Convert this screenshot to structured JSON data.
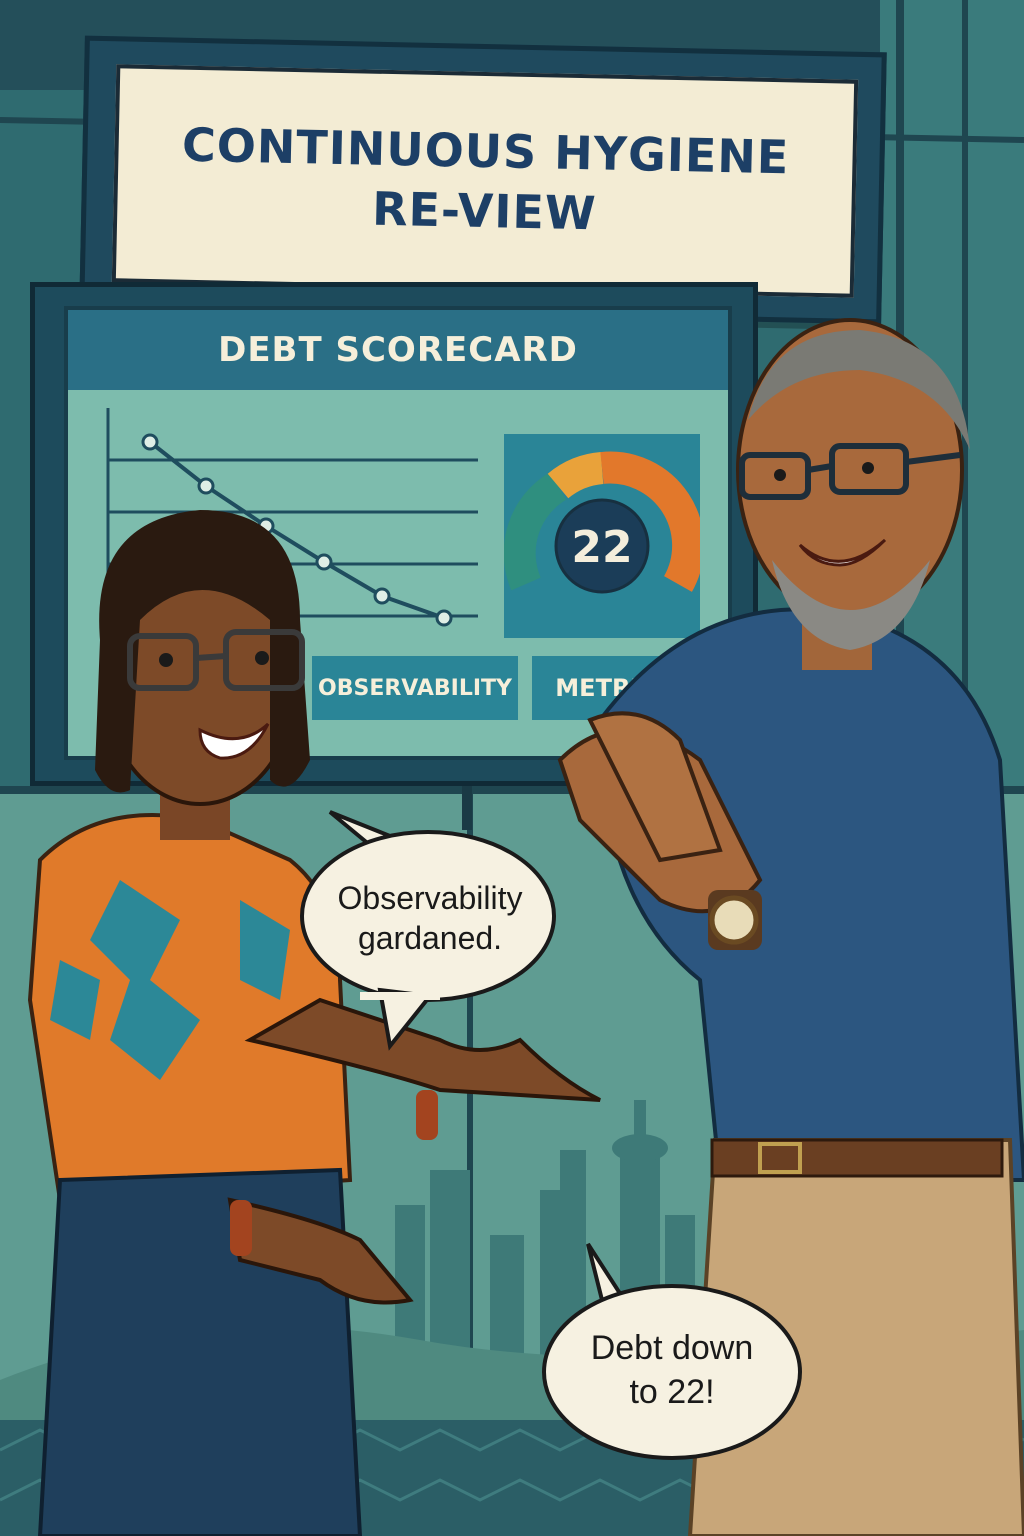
{
  "banner": {
    "line1": "CONTINUOUS HYGIENE",
    "line2": "RE-VIEW"
  },
  "scoreboard": {
    "title": "DEBT SCORECARD",
    "gauge_value": "22",
    "tile_left": "OBSERVABILITY",
    "tile_right": "METRICS"
  },
  "bubbles": {
    "woman_line1": "Observability",
    "woman_line2": "gardaned.",
    "man_line1": "Debt down",
    "man_line2": "to 22!"
  },
  "colors": {
    "wall": "#2f6b70",
    "banner_text": "#1d3f66",
    "screen": "#7dbcad",
    "gauge_orange": "#e2782b",
    "shirt_blue": "#2c5680"
  }
}
